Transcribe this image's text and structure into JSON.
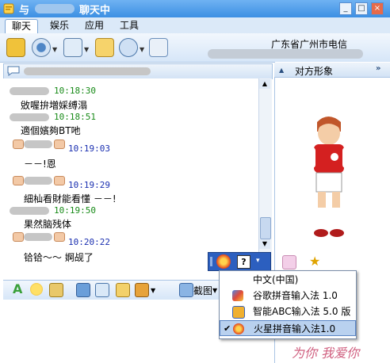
{
  "window": {
    "title_prefix": "与",
    "title_suffix": "聊天中",
    "buttons": [
      "_",
      "□",
      "×"
    ]
  },
  "tabs": [
    {
      "label": "聊天"
    },
    {
      "label": "娱乐"
    },
    {
      "label": "应用"
    },
    {
      "label": "工具"
    }
  ],
  "toolbar": {
    "icons": [
      "mail-icon",
      "webcam-icon",
      "voice-icon",
      "send-file-icon",
      "contact-card-icon",
      "add-friend-icon"
    ],
    "location": "广东省广州市电信"
  },
  "messages": [
    {
      "time": "10:18:30",
      "text": "敓喔拚増婇缚溻",
      "self": false
    },
    {
      "time": "10:18:51",
      "text": "適個嬪夠BT吔",
      "self": false
    },
    {
      "time": "10:19:03",
      "text": "－－!恩",
      "self": true
    },
    {
      "time": "10:19:29",
      "text": "細杣看財能看懂 －－!",
      "self": true
    },
    {
      "time": "10:19:50",
      "text": "果然脑残体",
      "self": false
    },
    {
      "time": "10:20:22",
      "text": "铪铪～～ 婀觇了",
      "self": true
    }
  ],
  "fontbar": {
    "screenshot_label": "截图"
  },
  "right_panel": {
    "title": "对方形象"
  },
  "ime_menu": {
    "items": [
      {
        "label": "中文(中国)",
        "icon": "",
        "checked": false
      },
      {
        "label": "谷歌拼音输入法 1.0",
        "icon": "google-pinyin-icon",
        "checked": false
      },
      {
        "label": "智能ABC输入法 5.0 版",
        "icon": "abc-ime-icon",
        "checked": false
      },
      {
        "label": "火星拼音输入法1.0",
        "icon": "mars-pinyin-icon",
        "checked": true
      }
    ]
  },
  "watermark": "为你 我爱你",
  "colors": {
    "title_bar": "#3c8fe3",
    "peer_time": "#178a17",
    "self_time": "#1a2fb0",
    "menu_selected": "#b9d1ef"
  }
}
